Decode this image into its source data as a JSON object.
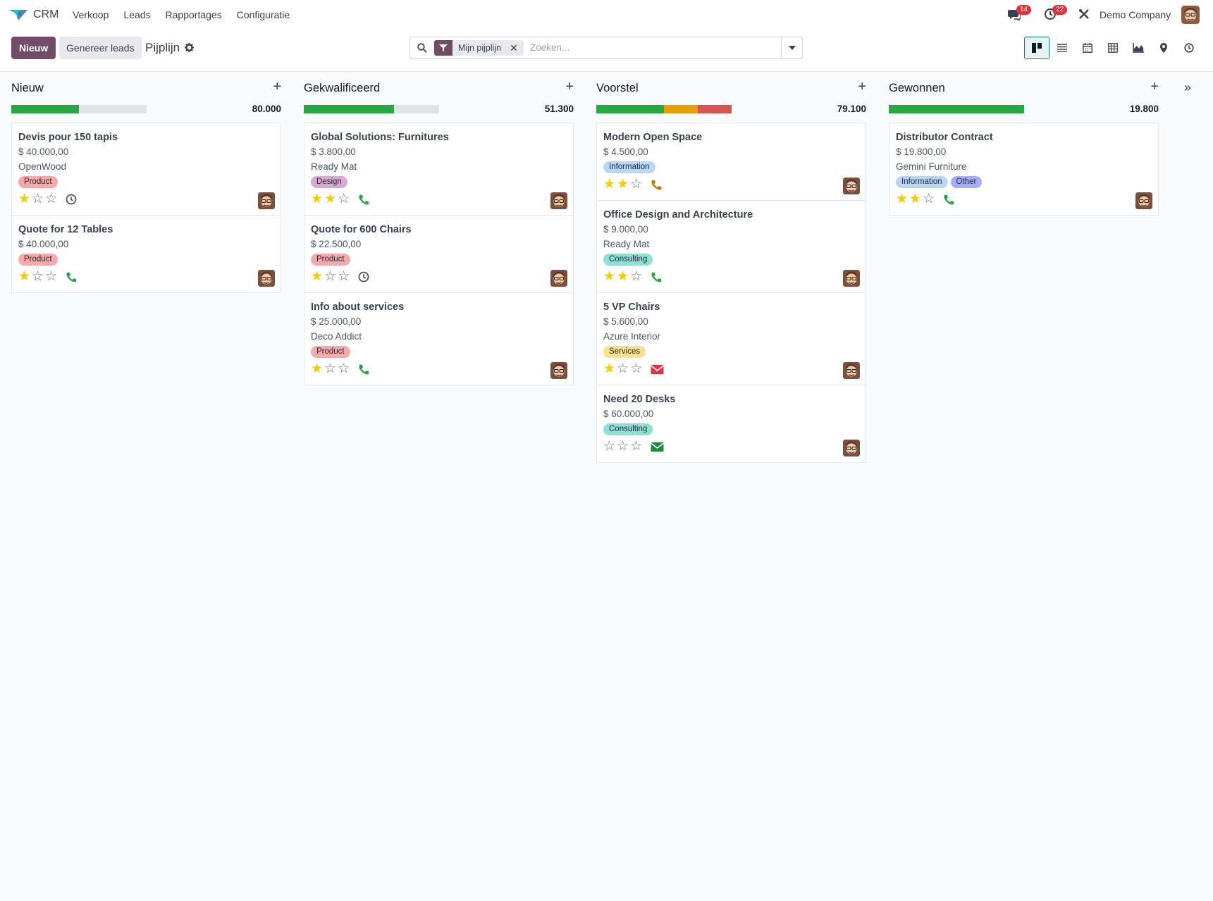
{
  "app": {
    "name": "CRM"
  },
  "menu": [
    "Verkoop",
    "Leads",
    "Rapportages",
    "Configuratie"
  ],
  "nav": {
    "messages_count": "14",
    "activities_count": "22",
    "company": "Demo Company"
  },
  "control": {
    "new_label": "Nieuw",
    "generate_label": "Genereer leads",
    "breadcrumb": "Pijplijn",
    "facet_label": "Mijn pijplijn",
    "search_placeholder": "Zoeken..."
  },
  "views": [
    "kanban",
    "list",
    "calendar",
    "pivot",
    "graph",
    "map",
    "activity"
  ],
  "active_view": "kanban",
  "colors": {
    "primary": "#714b67",
    "progress_green": "#28a745",
    "progress_orange": "#e6a000",
    "progress_red": "#d9534f",
    "activity_green": "#28a745",
    "activity_orange": "#b9770e",
    "activity_red": "#dc3545"
  },
  "columns": [
    {
      "title": "Nieuw",
      "total": "80.000",
      "progress": [
        {
          "color": "#28a745",
          "fraction": 0.5
        }
      ],
      "cards": [
        {
          "title": "Devis pour 150 tapis",
          "amount": "$ 40.000,00",
          "partner": "OpenWood",
          "tags": [
            {
              "label": "Product",
              "color": "#f7a8a8"
            }
          ],
          "stars": 1,
          "activity": "clock",
          "activity_color": "#4b5563"
        },
        {
          "title": "Quote for 12 Tables",
          "amount": "$ 40.000,00",
          "partner": "",
          "tags": [
            {
              "label": "Product",
              "color": "#f7a8a8"
            }
          ],
          "stars": 1,
          "activity": "phone",
          "activity_color": "#28a745"
        }
      ]
    },
    {
      "title": "Gekwalificeerd",
      "total": "51.300",
      "progress": [
        {
          "color": "#28a745",
          "fraction": 0.667
        }
      ],
      "cards": [
        {
          "title": "Global Solutions: Furnitures",
          "amount": "$ 3.800,00",
          "partner": "Ready Mat",
          "tags": [
            {
              "label": "Design",
              "color": "#d9a9cf"
            }
          ],
          "stars": 2,
          "activity": "phone",
          "activity_color": "#28a745"
        },
        {
          "title": "Quote for 600 Chairs",
          "amount": "$ 22.500,00",
          "partner": "",
          "tags": [
            {
              "label": "Product",
              "color": "#f7a8a8"
            }
          ],
          "stars": 1,
          "activity": "clock",
          "activity_color": "#4b5563"
        },
        {
          "title": "Info about services",
          "amount": "$ 25.000,00",
          "partner": "Deco Addict",
          "tags": [
            {
              "label": "Product",
              "color": "#f7a8a8"
            }
          ],
          "stars": 1,
          "activity": "phone",
          "activity_color": "#28a745"
        }
      ]
    },
    {
      "title": "Voorstel",
      "total": "79.100",
      "progress": [
        {
          "color": "#28a745",
          "fraction": 0.5
        },
        {
          "color": "#e6a000",
          "fraction": 0.25
        },
        {
          "color": "#d9534f",
          "fraction": 0.25
        }
      ],
      "cards": [
        {
          "title": "Modern Open Space",
          "amount": "$ 4.500,00",
          "partner": "",
          "tags": [
            {
              "label": "Information",
              "color": "#b9d7f5"
            }
          ],
          "stars": 2,
          "activity": "phone",
          "activity_color": "#b9770e"
        },
        {
          "title": "Office Design and Architecture",
          "amount": "$ 9.000,00",
          "partner": "Ready Mat",
          "tags": [
            {
              "label": "Consulting",
              "color": "#8ee0d2"
            }
          ],
          "stars": 2,
          "activity": "phone",
          "activity_color": "#28a745"
        },
        {
          "title": "5 VP Chairs",
          "amount": "$ 5.600,00",
          "partner": "Azure Interior",
          "tags": [
            {
              "label": "Services",
              "color": "#f9e08a"
            }
          ],
          "stars": 1,
          "activity": "envelope",
          "activity_color": "#dc3545"
        },
        {
          "title": "Need 20 Desks",
          "amount": "$ 60.000,00",
          "partner": "",
          "tags": [
            {
              "label": "Consulting",
              "color": "#8ee0d2"
            }
          ],
          "stars": 0,
          "activity": "envelope",
          "activity_color": "#1e8a3c"
        }
      ]
    },
    {
      "title": "Gewonnen",
      "total": "19.800",
      "progress": [
        {
          "color": "#28a745",
          "fraction": 1.0
        }
      ],
      "cards": [
        {
          "title": "Distributor Contract",
          "amount": "$ 19.800,00",
          "partner": "Gemini Furniture",
          "tags": [
            {
              "label": "Information",
              "color": "#b9d7f5"
            },
            {
              "label": "Other",
              "color": "#a5aef5"
            }
          ],
          "stars": 2,
          "activity": "phone",
          "activity_color": "#28a745"
        }
      ]
    }
  ]
}
